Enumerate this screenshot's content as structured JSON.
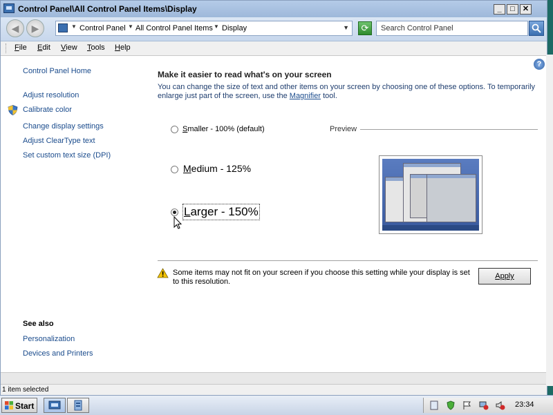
{
  "window": {
    "title": "Control Panel\\All Control Panel Items\\Display",
    "buttons": {
      "minimize": "_",
      "maximize": "□",
      "close": "✕"
    }
  },
  "navigation": {
    "breadcrumbs": [
      "Control Panel",
      "All Control Panel Items",
      "Display"
    ],
    "search_placeholder": "Search Control Panel"
  },
  "menubar": {
    "items": [
      {
        "label": "File",
        "underline": "F"
      },
      {
        "label": "Edit",
        "underline": "E"
      },
      {
        "label": "View",
        "underline": "V"
      },
      {
        "label": "Tools",
        "underline": "T"
      },
      {
        "label": "Help",
        "underline": "H"
      }
    ]
  },
  "sidebar": {
    "home": "Control Panel Home",
    "links": [
      "Adjust resolution",
      "Calibrate color",
      "Change display settings",
      "Adjust ClearType text",
      "Set custom text size (DPI)"
    ],
    "see_also_heading": "See also",
    "see_also": [
      "Personalization",
      "Devices and Printers"
    ]
  },
  "main": {
    "heading": "Make it easier to read what's on your screen",
    "description_before": "You can change the size of text and other items on your screen by choosing one of these options. To temporarily enlarge just part of the screen, use the ",
    "magnifier_link": "Magnifier",
    "description_after": " tool.",
    "options": [
      {
        "label": "Smaller - 100% (default)",
        "selected": false
      },
      {
        "label": "Medium - 125%",
        "selected": false
      },
      {
        "label": "Larger - 150%",
        "selected": true
      }
    ],
    "preview_label": "Preview",
    "warning": "Some items may not fit on your screen if you choose this setting while your display is set to this resolution.",
    "apply_label": "Apply"
  },
  "statusbar": {
    "text": "1 item selected"
  },
  "taskbar": {
    "start_label": "Start",
    "clock": "23:34"
  },
  "colors": {
    "link": "#1a4b8c",
    "titlebar": "#b4cbe8",
    "desktop": "#1d6a64"
  }
}
